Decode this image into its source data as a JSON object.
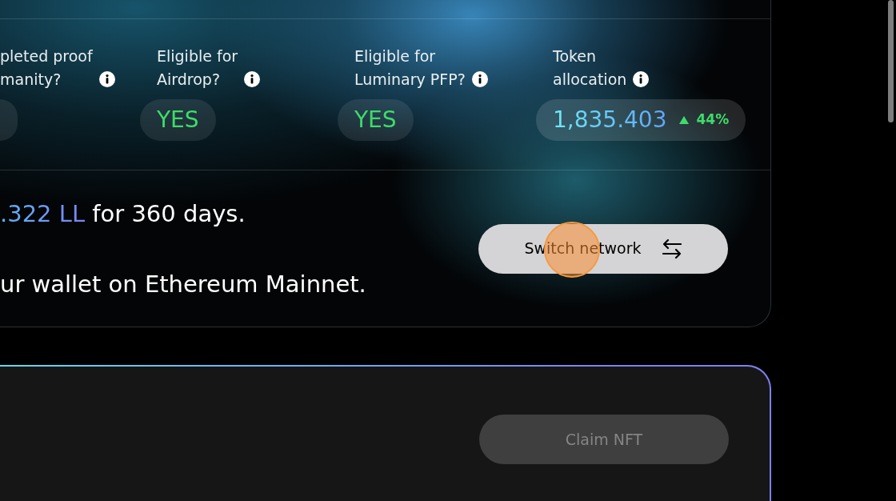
{
  "eligibility": [
    {
      "kind": "badge",
      "label_lines": [
        "pleted proof",
        "manity?"
      ]
    },
    {
      "kind": "badge",
      "label_lines": [
        "Eligible for",
        "Airdrop?"
      ],
      "value": "YES"
    },
    {
      "kind": "badge",
      "label_lines": [
        "Eligible for",
        "Luminary PFP?"
      ],
      "value": "YES"
    },
    {
      "kind": "amount",
      "label_lines": [
        "Token",
        "allocation"
      ],
      "value": "1,835.403",
      "change": {
        "up": true,
        "text": "44%"
      }
    }
  ],
  "lock_message": {
    "amount": ".322 LL",
    "text": "for 360 days."
  },
  "network_message": "ur wallet on Ethereum Mainnet.",
  "switch_button": {
    "label": "Switch network"
  },
  "claim_button": {
    "label": "Claim NFT",
    "disabled": true
  }
}
